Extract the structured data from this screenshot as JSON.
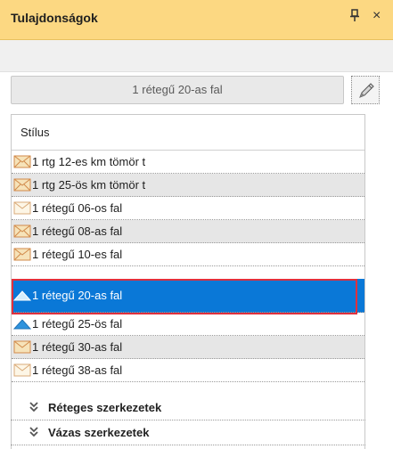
{
  "panel": {
    "title": "Tulajdonságok",
    "pin_glyph": "ᨏ",
    "close_glyph": "×"
  },
  "selector": {
    "value": "1 rétegű 20-as fal",
    "edit_icon": "pencil-icon"
  },
  "list": {
    "header": "Stílus",
    "items": [
      {
        "label": "1 rtg 12-es km tömör t",
        "icon": "envelope-icon",
        "alt": false
      },
      {
        "label": "1 rtg 25-ös km tömör t",
        "icon": "envelope-icon",
        "alt": true
      },
      {
        "label": "1 rétegű 06-os fal",
        "icon": "envelope-icon",
        "alt": false
      },
      {
        "label": "1 rétegű 08-as fal",
        "icon": "envelope-icon",
        "alt": true
      },
      {
        "label": "1 rétegű 10-es fal",
        "icon": "envelope-icon",
        "alt": false
      },
      {
        "label": "1 rétegű 20-as fal",
        "icon": "wall-icon",
        "alt": false,
        "selected": true
      },
      {
        "label": "1 rétegű 25-ös fal",
        "icon": "wall-icon",
        "alt": false
      },
      {
        "label": "1 rétegű 30-as fal",
        "icon": "envelope-icon",
        "alt": true
      },
      {
        "label": "1 rétegű 38-as fal",
        "icon": "envelope-icon",
        "alt": false
      }
    ]
  },
  "groups": [
    {
      "label": "Réteges szerkezetek",
      "chevron": "»"
    },
    {
      "label": "Vázas szerkezetek",
      "chevron": "»"
    }
  ],
  "colors": {
    "titlebar": "#fcd882",
    "selected": "#0a78d7",
    "highlight_outline": "#e0303d"
  }
}
